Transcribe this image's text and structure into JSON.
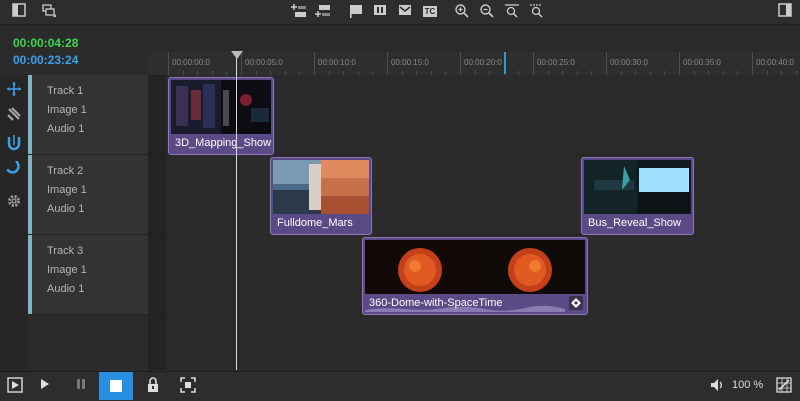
{
  "timecodes": {
    "current": "00:00:04:28",
    "total": "00:00:23:24"
  },
  "colors": {
    "current_tc": "#3dd64b",
    "total_tc": "#3aa0e8",
    "clip_bg": "#5a4a86",
    "accent": "#2a9bd8"
  },
  "toolbar": {
    "icons": [
      "panel-left-icon",
      "layers-icon",
      "insert-track-above-icon",
      "insert-track-below-icon",
      "flag-icon",
      "pause-marker-icon",
      "mail-marker-icon",
      "tc-marker-icon",
      "zoom-in-icon",
      "zoom-out-icon",
      "zoom-fit-icon",
      "zoom-selection-icon",
      "panel-right-icon"
    ],
    "tc_label": "TC"
  },
  "tools": [
    "move-icon",
    "razor-icon",
    "magnet-icon",
    "snap-icon",
    "settings-icon"
  ],
  "tracks": [
    {
      "name": "Track 1",
      "image": "Image 1",
      "audio": "Audio 1"
    },
    {
      "name": "Track 2",
      "image": "Image 1",
      "audio": "Audio 1"
    },
    {
      "name": "Track 3",
      "image": "Image 1",
      "audio": "Audio 1"
    }
  ],
  "ruler": [
    "00:00:00:0",
    "00:00:05:0",
    "00:00:10:0",
    "00:00:15:0",
    "00:00:20:0",
    "00:00:25:0",
    "00:00:30:0",
    "00:00:35:0",
    "00:00:40:0"
  ],
  "clips": [
    {
      "name": "3D_Mapping_Show"
    },
    {
      "name": "Fulldome_Mars"
    },
    {
      "name": "Bus_Reveal_Show"
    },
    {
      "name": "360-Dome-with-SpaceTime"
    }
  ],
  "bottom": {
    "volume": "100 %"
  }
}
